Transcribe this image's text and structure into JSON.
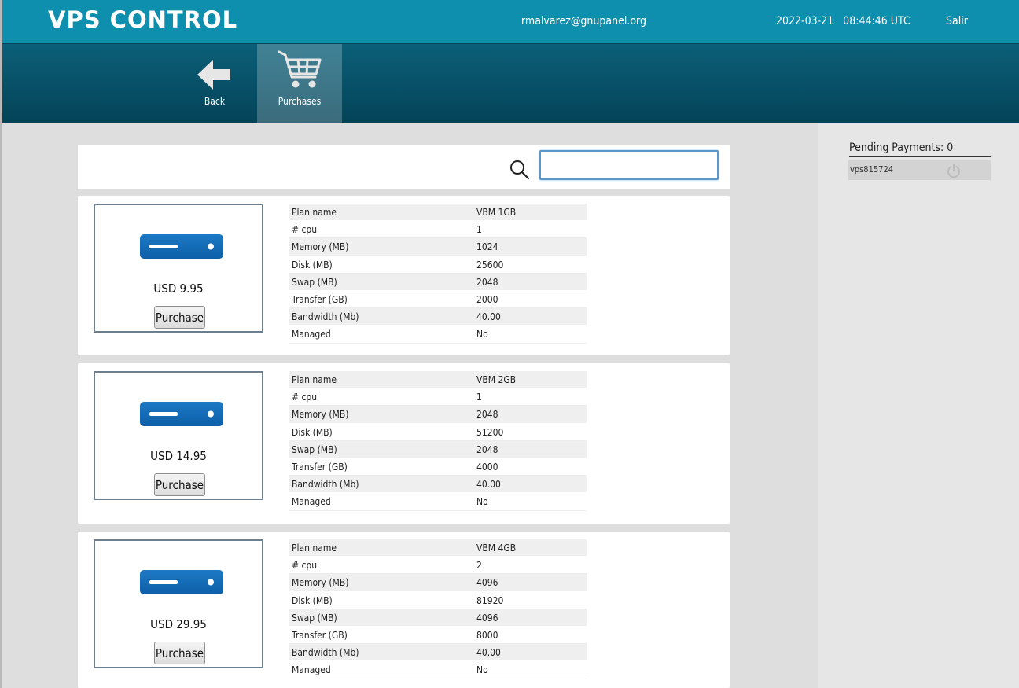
{
  "header": {
    "brand": "VPS CONTROL",
    "user_email": "rmalvarez@gnupanel.org",
    "datetime": "2022-03-21   08:44:46 UTC",
    "logout_label": "Salir"
  },
  "toolbar": {
    "back_label": "Back",
    "purchases_label": "Purchases"
  },
  "search": {
    "placeholder": "",
    "value": ""
  },
  "sidebar": {
    "pending_title": "Pending Payments: 0",
    "items": [
      {
        "id": "vps815724"
      }
    ]
  },
  "plans": [
    {
      "price": "USD 9.95",
      "button_label": "Purchase",
      "specs": [
        {
          "label": "Plan name",
          "value": "VBM 1GB"
        },
        {
          "label": "# cpu",
          "value": "1"
        },
        {
          "label": "Memory (MB)",
          "value": "1024"
        },
        {
          "label": "Disk (MB)",
          "value": "25600"
        },
        {
          "label": "Swap (MB)",
          "value": "2048"
        },
        {
          "label": "Transfer (GB)",
          "value": "2000"
        },
        {
          "label": "Bandwidth (Mb)",
          "value": "40.00"
        },
        {
          "label": "Managed",
          "value": "No"
        }
      ]
    },
    {
      "price": "USD 14.95",
      "button_label": "Purchase",
      "specs": [
        {
          "label": "Plan name",
          "value": "VBM 2GB"
        },
        {
          "label": "# cpu",
          "value": "1"
        },
        {
          "label": "Memory (MB)",
          "value": "2048"
        },
        {
          "label": "Disk (MB)",
          "value": "51200"
        },
        {
          "label": "Swap (MB)",
          "value": "2048"
        },
        {
          "label": "Transfer (GB)",
          "value": "4000"
        },
        {
          "label": "Bandwidth (Mb)",
          "value": "40.00"
        },
        {
          "label": "Managed",
          "value": "No"
        }
      ]
    },
    {
      "price": "USD 29.95",
      "button_label": "Purchase",
      "specs": [
        {
          "label": "Plan name",
          "value": "VBM 4GB"
        },
        {
          "label": "# cpu",
          "value": "2"
        },
        {
          "label": "Memory (MB)",
          "value": "4096"
        },
        {
          "label": "Disk (MB)",
          "value": "81920"
        },
        {
          "label": "Swap (MB)",
          "value": "4096"
        },
        {
          "label": "Transfer (GB)",
          "value": "8000"
        },
        {
          "label": "Bandwidth (Mb)",
          "value": "40.00"
        },
        {
          "label": "Managed",
          "value": "No"
        }
      ]
    }
  ]
}
